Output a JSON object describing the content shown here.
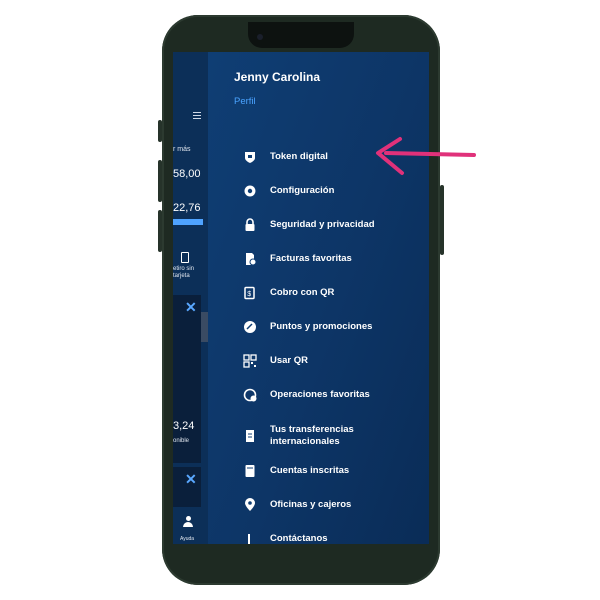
{
  "user": {
    "name": "Jenny Carolina",
    "profile_link": "Perfil"
  },
  "menu": [
    {
      "label": "Token digital",
      "icon": "shield-icon"
    },
    {
      "label": "Configuración",
      "icon": "gear-icon"
    },
    {
      "label": "Seguridad y privacidad",
      "icon": "lock-icon"
    },
    {
      "label": "Facturas favoritas",
      "icon": "invoice-icon"
    },
    {
      "label": "Cobro con QR",
      "icon": "qr-payment-icon"
    },
    {
      "label": "Puntos y promociones",
      "icon": "points-icon"
    },
    {
      "label": "Usar QR",
      "icon": "qr-code-icon"
    },
    {
      "label": "Operaciones favoritas",
      "icon": "favorite-operations-icon"
    },
    {
      "label": "Tus transferencias\ninternacionales",
      "icon": "international-transfer-icon"
    },
    {
      "label": "Cuentas inscritas",
      "icon": "accounts-icon"
    },
    {
      "label": "Oficinas y cajeros",
      "icon": "location-pin-icon"
    },
    {
      "label": "Contáctanos",
      "icon": "contact-icon"
    }
  ],
  "background_app": {
    "see_more": "r más",
    "amount_1": "58,00",
    "amount_2": "22,76",
    "withdraw_label": "etiro sin\ntarjeta",
    "amount_3": "3,24",
    "amount_3_caption": "onible",
    "help_label": "Ayuda"
  },
  "colors": {
    "panel": "#0f3e74",
    "accent": "#4aa3ff",
    "arrow": "#e0317a"
  }
}
